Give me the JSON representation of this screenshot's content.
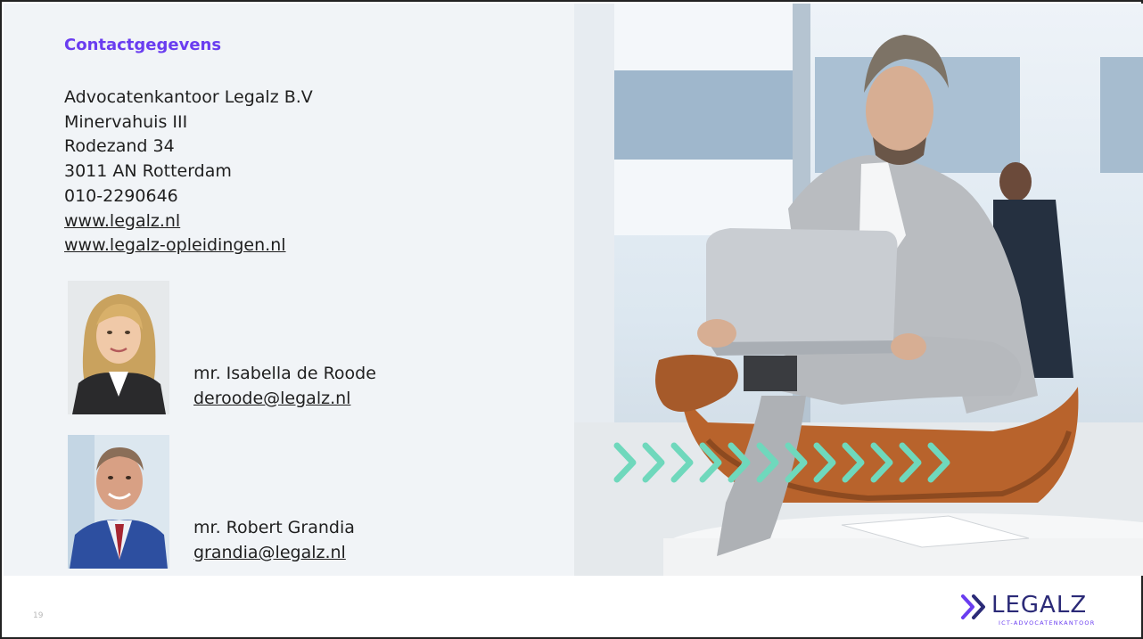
{
  "contact": {
    "heading": "Contactgegevens",
    "company": "Advocatenkantoor Legalz B.V",
    "building": "Minervahuis III",
    "street": "Rodezand 34",
    "city": "3011 AN Rotterdam",
    "phone": "010-2290646",
    "website1": "www.legalz.nl",
    "website2": "www.legalz-opleidingen.nl"
  },
  "people": [
    {
      "name": "mr. Isabella de Roode",
      "email": "deroode@legalz.nl"
    },
    {
      "name": "mr. Robert Grandia",
      "email": "grandia@legalz.nl"
    }
  ],
  "footer": {
    "page_number": "19",
    "logo_text": "LEGALZ",
    "logo_subtext": "ICT-ADVOCATENKANTOOR"
  },
  "colors": {
    "accent": "#6a3df0",
    "logo_navy": "#2b2a77",
    "chevrons": "#6fd8bc",
    "panel_bg": "#f1f4f7"
  }
}
